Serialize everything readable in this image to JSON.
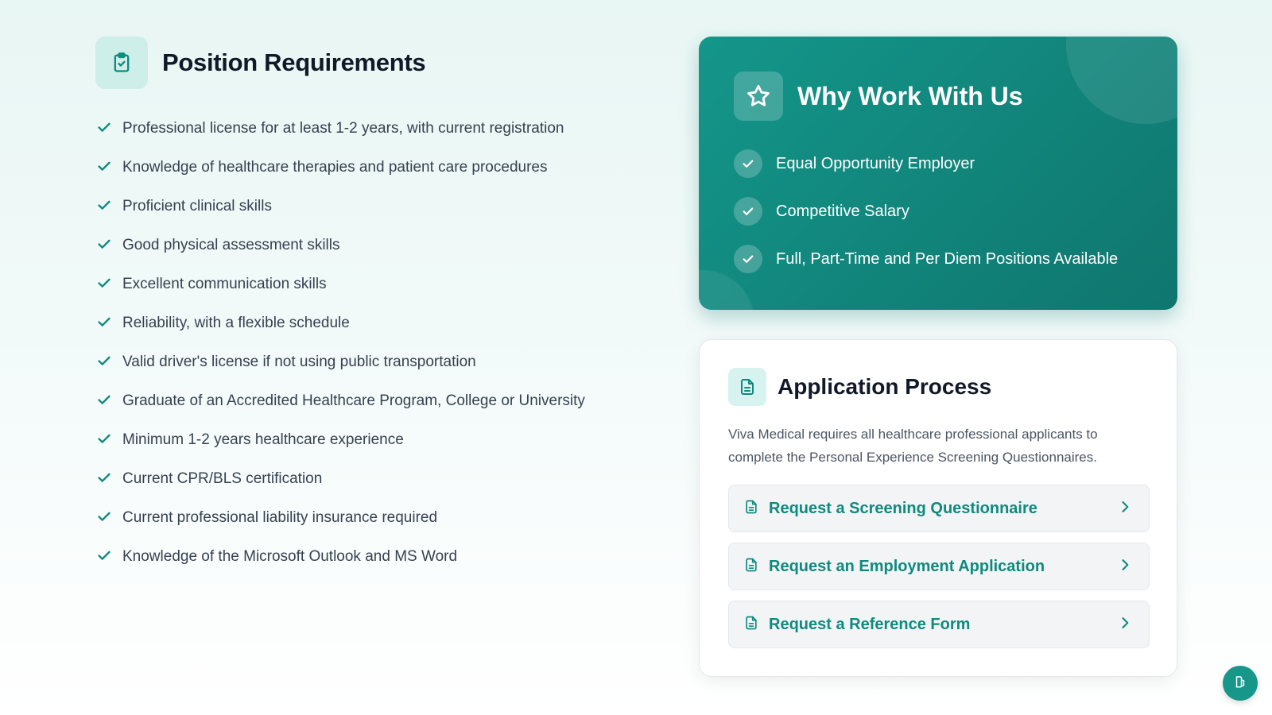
{
  "requirements": {
    "title": "Position Requirements",
    "icon": "clipboard-check-icon",
    "items": [
      "Professional license for at least 1-2 years, with current registration",
      "Knowledge of healthcare therapies and patient care procedures",
      "Proficient clinical skills",
      "Good physical assessment skills",
      "Excellent communication skills",
      "Reliability, with a flexible schedule",
      "Valid driver's license if not using public transportation",
      "Graduate of an Accredited Healthcare Program, College or University",
      "Minimum 1-2 years healthcare experience",
      "Current CPR/BLS certification",
      "Current professional liability insurance required",
      "Knowledge of the Microsoft Outlook and MS Word"
    ]
  },
  "why_work": {
    "title": "Why Work With Us",
    "icon": "star-icon",
    "items": [
      "Equal Opportunity Employer",
      "Competitive Salary",
      "Full, Part-Time and Per Diem Positions Available"
    ]
  },
  "application": {
    "title": "Application Process",
    "icon": "document-icon",
    "description": "Viva Medical requires all healthcare professional applicants to complete the Personal Experience Screening Questionnaires.",
    "links": [
      "Request a Screening Questionnaire",
      "Request an Employment Application",
      "Request a Reference Form"
    ]
  },
  "floating_button": {
    "icon": "accessibility-icon"
  },
  "colors": {
    "accent": "#0f8a7e",
    "card_gradient_start": "#14968a",
    "card_gradient_end": "#0f766e",
    "icon_bg": "#cdeee9"
  }
}
